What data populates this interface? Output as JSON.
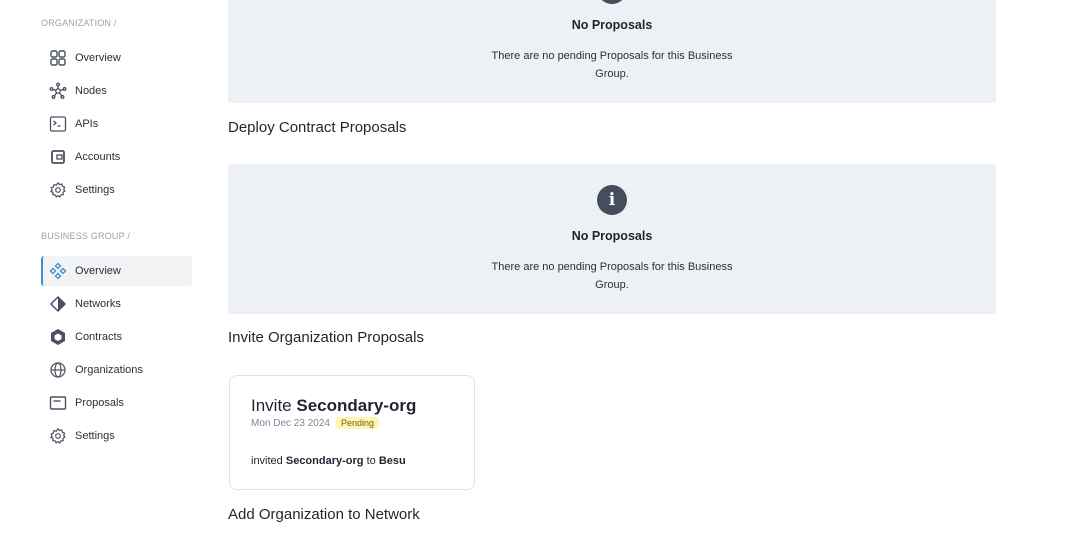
{
  "sidebar": {
    "org_label": "ORGANIZATION /",
    "org_items": [
      {
        "label": "Overview",
        "icon": "grid-icon"
      },
      {
        "label": "Nodes",
        "icon": "nodes-icon"
      },
      {
        "label": "APIs",
        "icon": "terminal-icon"
      },
      {
        "label": "Accounts",
        "icon": "wallet-icon"
      },
      {
        "label": "Settings",
        "icon": "gear-icon"
      }
    ],
    "bg_label": "BUSINESS GROUP /",
    "bg_items": [
      {
        "label": "Overview",
        "icon": "diamonds-icon",
        "active": true
      },
      {
        "label": "Networks",
        "icon": "network-diamond-icon"
      },
      {
        "label": "Contracts",
        "icon": "hexagon-icon"
      },
      {
        "label": "Organizations",
        "icon": "globe-icon"
      },
      {
        "label": "Proposals",
        "icon": "proposal-card-icon"
      },
      {
        "label": "Settings",
        "icon": "gear-icon"
      }
    ]
  },
  "main": {
    "empty_title": "No Proposals",
    "empty_desc": "There are no pending Proposals for this Business Group.",
    "info_icon": "i",
    "section_deploy": "Deploy Contract Proposals",
    "section_invite": "Invite Organization Proposals",
    "section_add": "Add Organization to Network",
    "card": {
      "title_prefix": "Invite",
      "title_org": "Secondary-org",
      "date": "Mon Dec 23 2024",
      "status": "Pending",
      "desc_prefix": "invited",
      "desc_org": "Secondary-org",
      "desc_mid": "to",
      "desc_network": "Besu"
    }
  },
  "colors": {
    "accent": "#3b8fd6",
    "panel": "#edf1f5",
    "badge": "#fdf7b5"
  }
}
